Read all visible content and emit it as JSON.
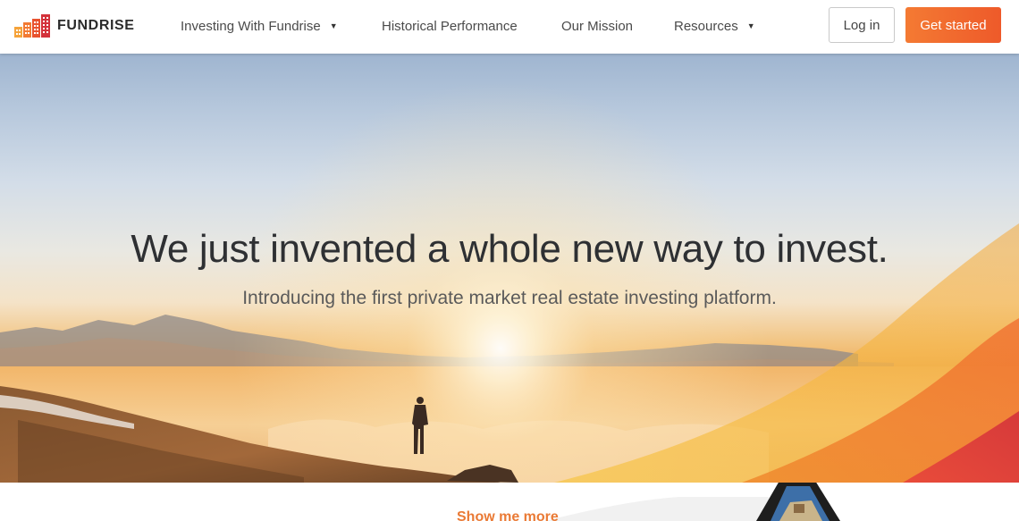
{
  "brand": {
    "name": "FUNDRISE",
    "colors": {
      "orange": "#f47a33",
      "red": "#d3313a",
      "accent_text": "#ea7a35"
    }
  },
  "nav": {
    "items": [
      {
        "label": "Investing With Fundrise",
        "has_dropdown": true
      },
      {
        "label": "Historical Performance",
        "has_dropdown": false
      },
      {
        "label": "Our Mission",
        "has_dropdown": false
      },
      {
        "label": "Resources",
        "has_dropdown": true
      }
    ],
    "dropdown_icon": "caret-down-icon",
    "caret_glyph": "▼"
  },
  "auth": {
    "login_label": "Log in",
    "get_started_label": "Get started"
  },
  "hero": {
    "heading": "We just invented a whole new way to invest.",
    "subheading": "Introducing the first private market real estate investing platform."
  },
  "below": {
    "show_more_label": "Show me more"
  }
}
